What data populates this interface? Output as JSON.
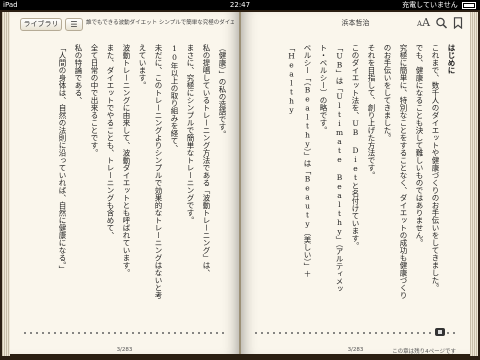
{
  "status": {
    "device": "iPad",
    "time": "22:47",
    "charging": "充電していません"
  },
  "toolbar": {
    "library_label": "ライブラリ",
    "toc_icon": "list-icon",
    "book_title": "誰でもできる波動ダイエット シンプルで簡単な究極のダイエ...",
    "author": "浜本哲治",
    "font_label_small": "A",
    "font_label_large": "A",
    "search_icon": "search-icon",
    "bookmark_icon": "bookmark-icon"
  },
  "left_page": {
    "lines": [
      "（健康）」の私の造語です。",
      "私の提唱しているトレーニング方法である「波動トレーニング」は、",
      "まさに、究極にシンプルで簡単なトレーニングです。",
      "10年以上の取り組みを経て、",
      "未だに、このトレーニングよりシンプルで効果的なトレーニングはないと考えています。",
      "波動トレーニングに由来して、波動ダイエットとも呼ばれています。",
      "また、ダイエットでやることも、トレーニングも含めて、",
      "全て日常の中で出来ることです。",
      "私の特論である、",
      "「人間の身体は、自然の法則に沿っていれば、自然に健康になる。」"
    ],
    "page_number": "3/283"
  },
  "right_page": {
    "lines": [
      "はじめに",
      "これまで、数千人のダイエットや健康づくりのお手伝いをしてきました。",
      "でも、健康になることも決して難しいものではありません。",
      "究極に簡単に、特別なことをすることなく、ダイエットの成功も健康づくりのお手伝いをしてきました。",
      "それを目指して、創り上げた方法です。",
      "このダイエット法を、UB Dietと名付けています。",
      "「UB」は「Ultimate Bealthy」（アルティメット・ベルシー）の略です。",
      "ベルシー「（Bealthy）」は「Beauty（美しい）」＋「Healthy"
    ],
    "page_number": "3/283",
    "remaining": "この章は残り4ページです"
  }
}
